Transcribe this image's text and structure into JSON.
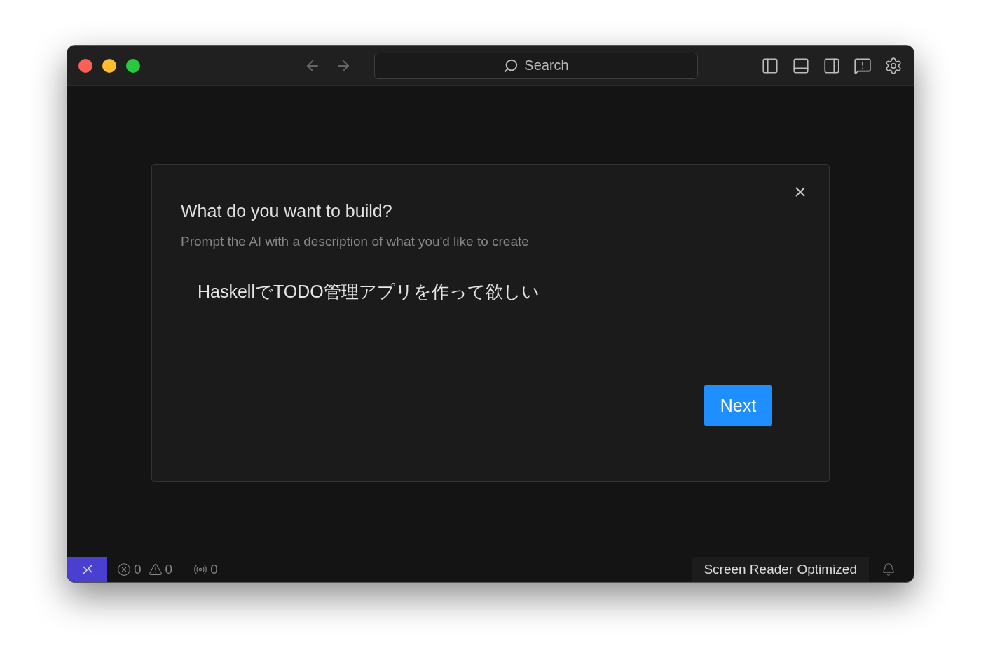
{
  "titlebar": {
    "search": {
      "placeholder": "Search"
    }
  },
  "dialog": {
    "title": "What do you want to build?",
    "subtitle": "Prompt the AI with a description of what you'd like to create",
    "prompt": {
      "value": "HaskellでTODO管理アプリを作って欲しい"
    },
    "next_button": "Next"
  },
  "status_bar": {
    "errors": "0",
    "warnings": "0",
    "ports": "0",
    "screen_reader": "Screen Reader Optimized"
  }
}
